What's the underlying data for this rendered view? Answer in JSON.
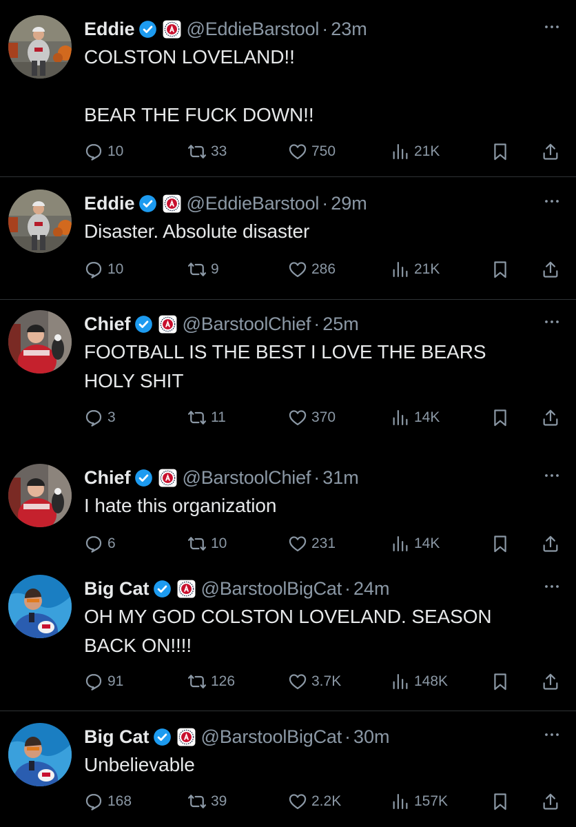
{
  "tweets": [
    {
      "name": "Eddie",
      "handle": "@EddieBarstool",
      "time": "23m",
      "text": "COLSTON LOVELAND!!\n\nBEAR THE FUCK DOWN!!",
      "replies": "10",
      "retweets": "33",
      "likes": "750",
      "views": "21K",
      "avatar": "eddie"
    },
    {
      "name": "Eddie",
      "handle": "@EddieBarstool",
      "time": "29m",
      "text": "Disaster. Absolute disaster",
      "replies": "10",
      "retweets": "9",
      "likes": "286",
      "views": "21K",
      "avatar": "eddie"
    },
    {
      "name": "Chief",
      "handle": "@BarstoolChief",
      "time": "25m",
      "text": "FOOTBALL IS THE BEST I LOVE THE BEARS\nHOLY SHIT",
      "replies": "3",
      "retweets": "11",
      "likes": "370",
      "views": "14K",
      "avatar": "chief"
    },
    {
      "name": "Chief",
      "handle": "@BarstoolChief",
      "time": "31m",
      "text": "I hate this organization",
      "replies": "6",
      "retweets": "10",
      "likes": "231",
      "views": "14K",
      "avatar": "chief"
    },
    {
      "name": "Big Cat",
      "handle": "@BarstoolBigCat",
      "time": "24m",
      "text": "OH MY GOD COLSTON LOVELAND. SEASON\nBACK ON!!!!",
      "replies": "91",
      "retweets": "126",
      "likes": "3.7K",
      "views": "148K",
      "avatar": "bigcat"
    },
    {
      "name": "Big Cat",
      "handle": "@BarstoolBigCat",
      "time": "30m",
      "text": "Unbelievable",
      "replies": "168",
      "retweets": "39",
      "likes": "2.2K",
      "views": "157K",
      "avatar": "bigcat"
    }
  ],
  "time_separator": "·",
  "icons": {
    "reply": "reply-icon",
    "retweet": "retweet-icon",
    "like": "heart-icon",
    "views": "views-icon",
    "bookmark": "bookmark-icon",
    "share": "share-icon",
    "verified": "verified-badge-icon",
    "affiliate": "barstool-affiliate-icon",
    "more": "more-icon"
  },
  "colors": {
    "background": "#000000",
    "text": "#e7e9ea",
    "muted": "#8b98a5",
    "verified": "#1d9bf0",
    "divider": "#2f3336",
    "brand": "#c8102e"
  }
}
